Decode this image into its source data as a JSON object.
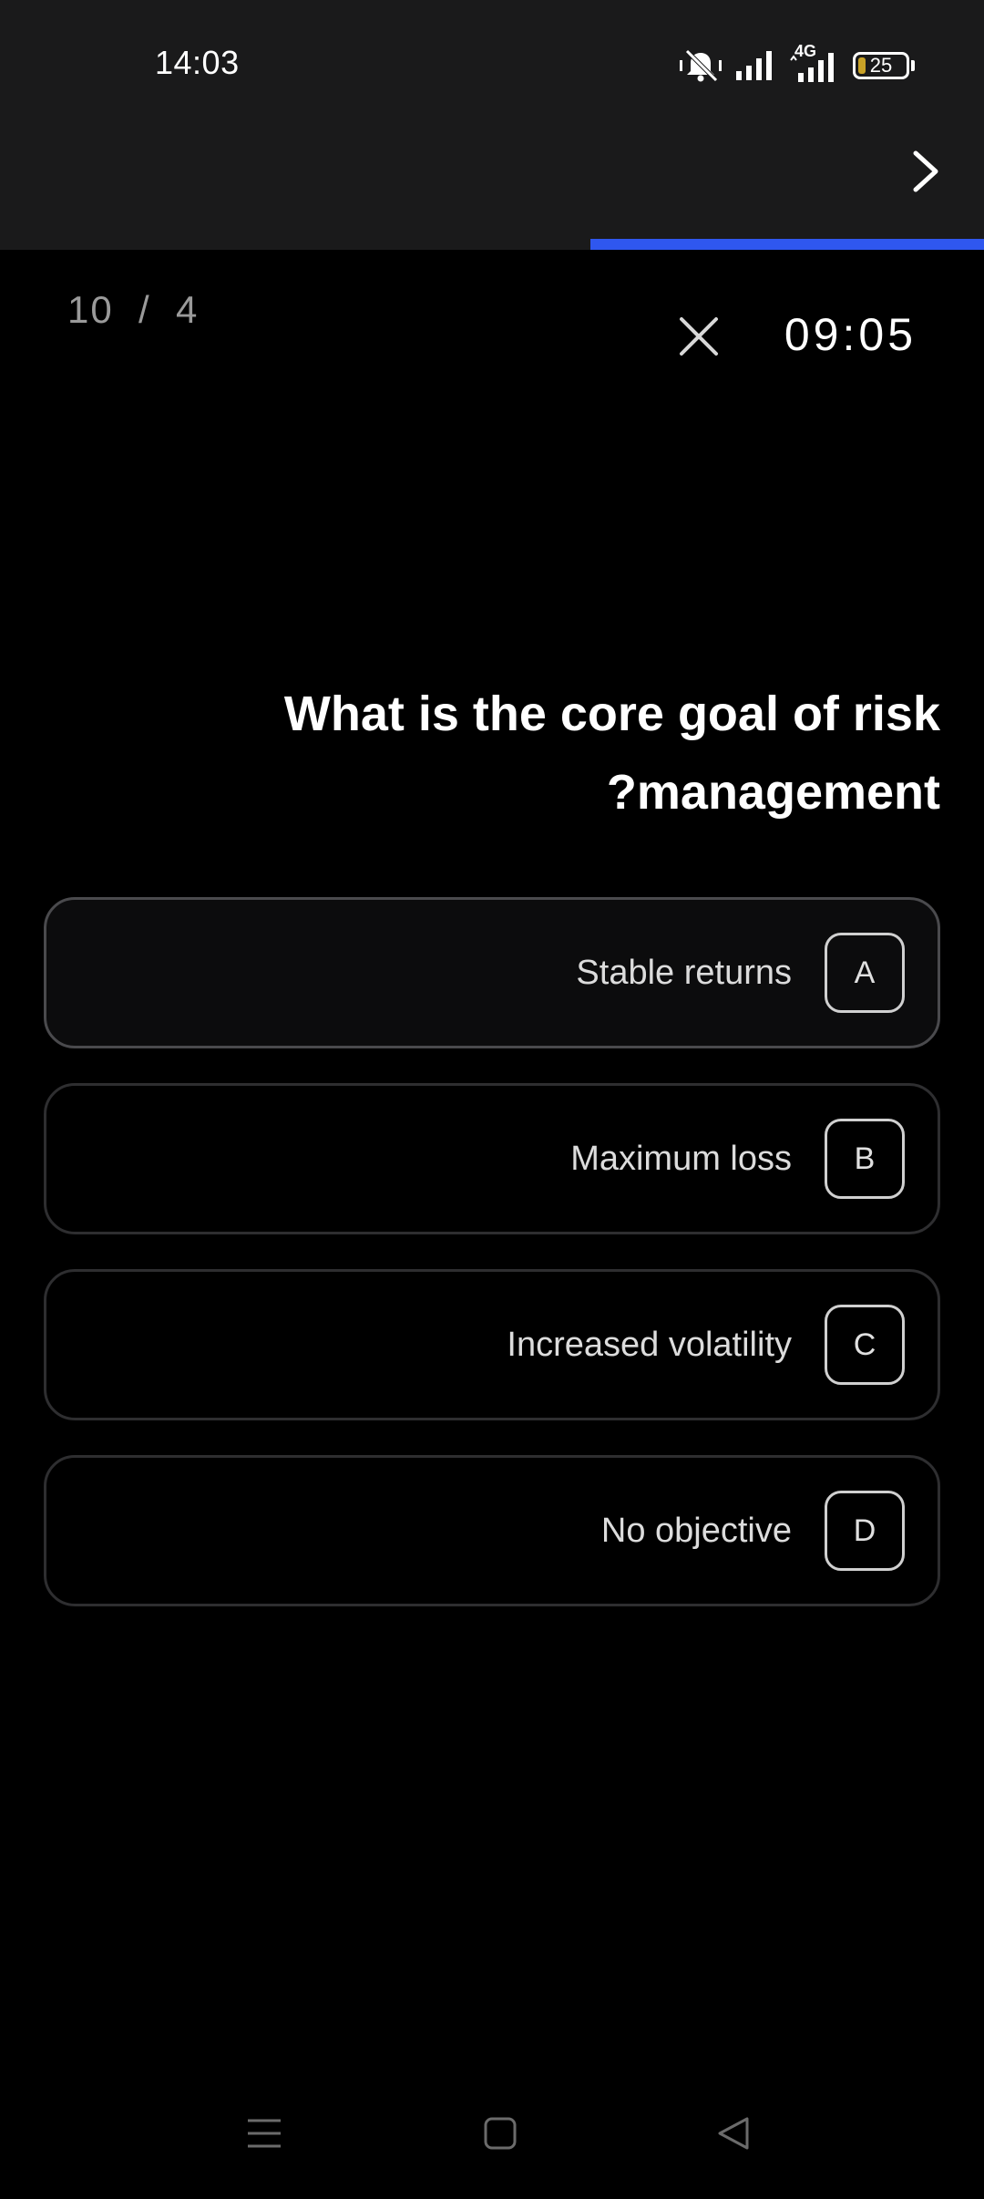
{
  "status_bar": {
    "time": "14:03",
    "network": "4G",
    "battery": "25",
    "battery_level": 0.25,
    "icons": [
      "mute-vibrate-icon",
      "signal-icon",
      "signal-4g-icon",
      "battery-icon"
    ]
  },
  "header": {
    "next_icon": "chevron-right-icon",
    "progress_fraction": 0.4
  },
  "quiz": {
    "counter": "10  /  4",
    "timer": "09:05",
    "close_icon": "close-icon",
    "question": "What is the core goal of risk\n?management",
    "options": [
      {
        "letter": "A",
        "label": "Stable returns"
      },
      {
        "letter": "B",
        "label": "Maximum loss"
      },
      {
        "letter": "C",
        "label": "Increased volatility"
      },
      {
        "letter": "D",
        "label": "No objective"
      }
    ]
  },
  "nav": {
    "icons": [
      "menu-icon",
      "home-icon",
      "back-icon"
    ]
  },
  "colors": {
    "accent": "#2f57ef",
    "header_bg": "#1a1a1b",
    "background": "#000000",
    "battery_fill": "#c9a227"
  }
}
